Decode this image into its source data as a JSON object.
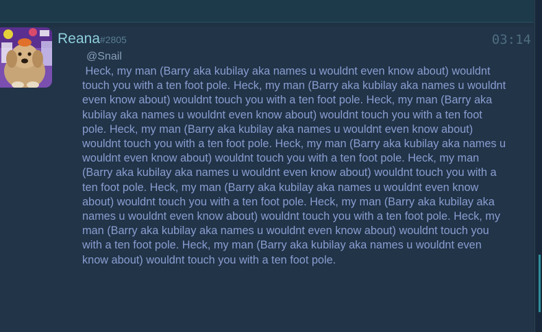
{
  "message": {
    "author": "Reana",
    "tag": "#2805",
    "time": "03:14",
    "mention": "@Snail",
    "text": " Heck, my man (Barry aka kubilay aka names u wouldnt even know about) wouldnt touch you with a ten foot pole. Heck, my man (Barry aka kubilay aka names u wouldnt even know about) wouldnt touch you with a ten foot pole. Heck, my man (Barry aka kubilay aka names u wouldnt even know about) wouldnt touch you with a ten foot pole. Heck, my man (Barry aka kubilay aka names u wouldnt even know about) wouldnt touch you with a ten foot pole. Heck, my man (Barry aka kubilay aka names u wouldnt even know about) wouldnt touch you with a ten foot pole. Heck, my man (Barry aka kubilay aka names u wouldnt even know about) wouldnt touch you with a ten foot pole. Heck, my man (Barry aka kubilay aka names u wouldnt even know about) wouldnt touch you with a ten foot pole. Heck, my man (Barry aka kubilay aka names u wouldnt even know about) wouldnt touch you with a ten foot pole. Heck, my man (Barry aka kubilay aka names u wouldnt even know about) wouldnt touch you with a ten foot pole. Heck, my man (Barry aka kubilay aka names u wouldnt even know about) wouldnt touch you with a ten foot pole."
  },
  "avatar": {
    "icon": "dog-avatar-icon"
  },
  "colors": {
    "username": "#8fd0dc",
    "text": "#8b9dd0",
    "background": "#213448",
    "accent": "#2f8f9a"
  }
}
